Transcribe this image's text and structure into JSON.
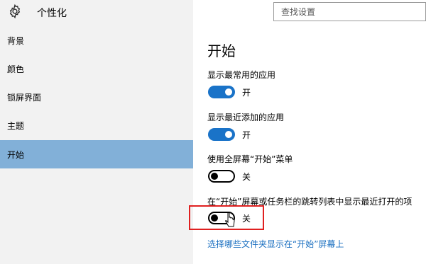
{
  "header": {
    "title": "个性化",
    "icon": "gear-icon"
  },
  "search": {
    "placeholder": "查找设置",
    "value": ""
  },
  "sidebar": {
    "items": [
      {
        "label": "背景",
        "selected": false
      },
      {
        "label": "颜色",
        "selected": false
      },
      {
        "label": "锁屏界面",
        "selected": false
      },
      {
        "label": "主题",
        "selected": false
      },
      {
        "label": "开始",
        "selected": true
      }
    ]
  },
  "main": {
    "title": "开始",
    "settings": [
      {
        "label": "显示最常用的应用",
        "state": "开",
        "on": true
      },
      {
        "label": "显示最近添加的应用",
        "state": "开",
        "on": true
      },
      {
        "label": "使用全屏幕“开始”菜单",
        "state": "关",
        "on": false
      },
      {
        "label": "在“开始”屏幕或任务栏的跳转列表中显示最近打开的项",
        "state": "关",
        "on": false
      }
    ],
    "link": "选择哪些文件夹显示在“开始”屏幕上"
  },
  "colors": {
    "accent": "#1a73c8",
    "selected_nav": "#82b0d8",
    "highlight_box": "#e02020",
    "link": "#1a6fc0"
  }
}
